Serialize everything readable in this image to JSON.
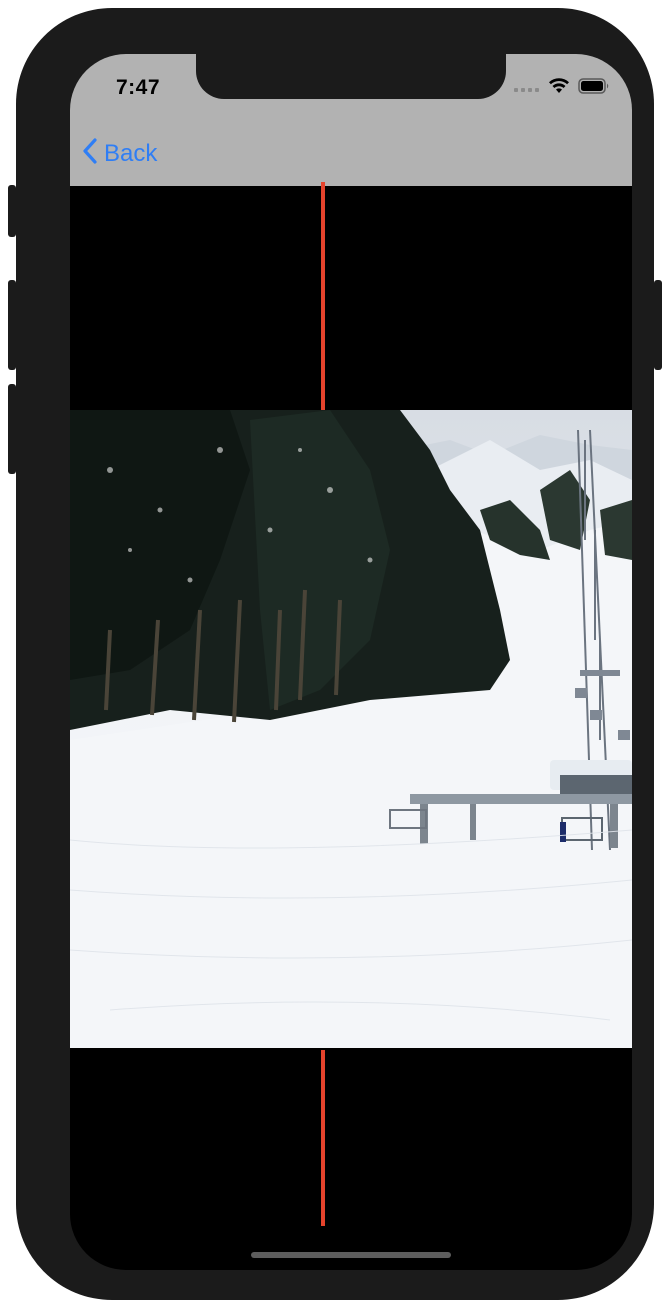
{
  "status_bar": {
    "time": "7:47"
  },
  "nav": {
    "back_label": "Back"
  },
  "photo": {
    "description_icon": "ski-slope-photo-icon"
  },
  "colors": {
    "accent": "#2f7ef5",
    "guide_line": "#e5432c",
    "navbar": "#b2b2b2"
  }
}
